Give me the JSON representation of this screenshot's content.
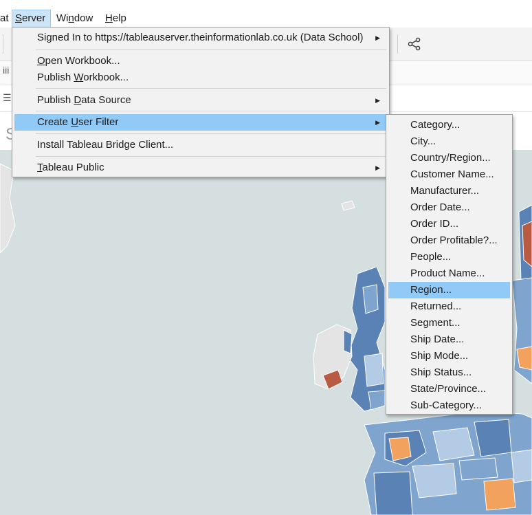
{
  "menubar": {
    "items": [
      {
        "label": "at",
        "underline_index": -1
      },
      {
        "label": "Server",
        "underline_index": 0
      },
      {
        "label": "Window",
        "underline_index": 2
      },
      {
        "label": "Help",
        "underline_index": 0
      }
    ]
  },
  "toolbar": {
    "share_icon": "share-icon",
    "row2_glyph": "iii",
    "row3_glyph": "☰"
  },
  "sheet": {
    "title_partial": "S"
  },
  "server_menu": {
    "items": [
      {
        "label": "Signed In to https://tableauserver.theinformationlab.co.uk (Data School)",
        "has_submenu": true
      },
      {
        "label": "Open Workbook...",
        "has_submenu": false
      },
      {
        "label": "Publish Workbook...",
        "has_submenu": false
      },
      {
        "label": "Publish Data Source",
        "has_submenu": true
      },
      {
        "label": "Create User Filter",
        "has_submenu": true,
        "highlighted": true
      },
      {
        "label": "Install Tableau Bridge Client...",
        "has_submenu": false
      },
      {
        "label": "Tableau Public",
        "has_submenu": true
      }
    ]
  },
  "user_filter_submenu": {
    "items": [
      "Category...",
      "City...",
      "Country/Region...",
      "Customer Name...",
      "Manufacturer...",
      "Order Date...",
      "Order ID...",
      "Order Profitable?...",
      "People...",
      "Product Name...",
      "Region...",
      "Returned...",
      "Segment...",
      "Ship Date...",
      "Ship Mode...",
      "Ship Status...",
      "State/Province...",
      "Sub-Category..."
    ],
    "highlighted": "Region..."
  },
  "colors": {
    "highlight": "#91c9f7",
    "menu_bg": "#f2f2f2",
    "sea": "#d5dfdf",
    "land_blue_dark": "#5a82b4",
    "land_blue_mid": "#7fa5cf",
    "land_blue_light": "#b3cbe4",
    "land_orange": "#f3a25e",
    "land_red": "#b95a42",
    "land_grey": "#e4e4e4"
  }
}
